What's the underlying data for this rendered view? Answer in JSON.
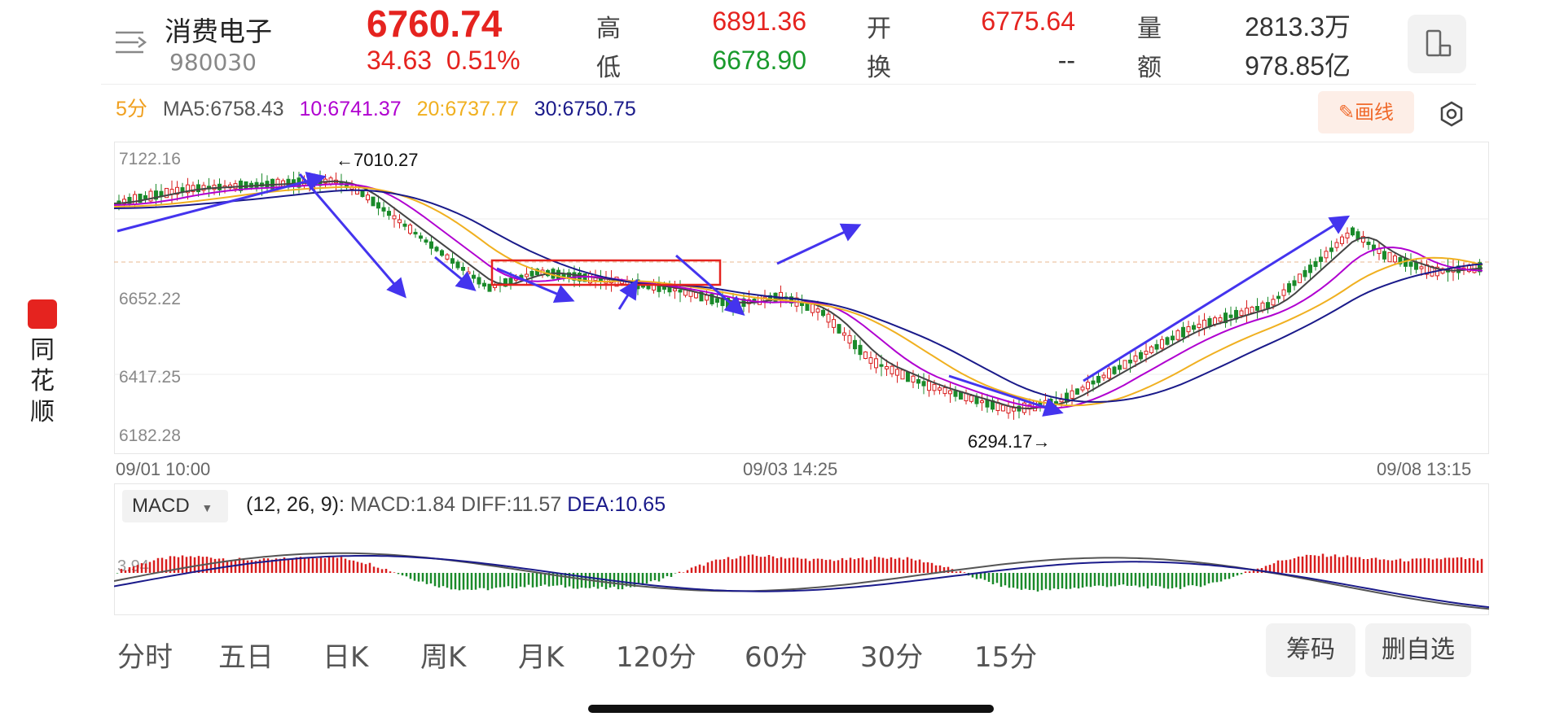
{
  "header": {
    "name": "消费电子",
    "code": "980030",
    "price": "6760.74",
    "change": "34.63",
    "change_pct": "0.51%",
    "quotes": [
      {
        "label": "高",
        "value": "6891.36",
        "color": "#e5231f"
      },
      {
        "label": "低",
        "value": "6678.90",
        "color": "#1a9a2c"
      },
      {
        "label": "开",
        "value": "6775.64",
        "color": "#e5231f"
      },
      {
        "label": "换",
        "value": "--",
        "color": "#333333"
      },
      {
        "label": "量",
        "value": "2813.3万",
        "color": "#333333"
      },
      {
        "label": "额",
        "value": "978.85亿",
        "color": "#333333"
      }
    ]
  },
  "ma_bar": {
    "period": "5分",
    "ma5": "MA5:6758.43",
    "ma10": "10:6741.37",
    "ma20": "20:6737.77",
    "ma30": "30:6750.75",
    "draw_label": "画线"
  },
  "chart_data": {
    "type": "candlestick",
    "y_ticks": [
      "7122.16",
      "6652.22",
      "6417.25",
      "6182.28"
    ],
    "x_ticks": [
      "09/01 10:00",
      "09/03 14:25",
      "09/08 13:15"
    ],
    "annotations": {
      "high": "←7010.27",
      "low": "6294.17→"
    },
    "colors": {
      "up": "#d81e1e",
      "down": "#1a8a2a",
      "ma5": "#444444",
      "ma10": "#b000d0",
      "ma20": "#f0b020",
      "ma30": "#1a1a8a",
      "trend": "#4434ee",
      "box": "#e5231f"
    }
  },
  "macd": {
    "selector": "MACD",
    "params": "(12, 26, 9):",
    "macd": "MACD:1.84",
    "diff": "DIFF:11.57",
    "dea": "DEA:10.65",
    "axis_label": "3.94"
  },
  "tabs": [
    "分时",
    "五日",
    "日K",
    "周K",
    "月K",
    "120分",
    "60分",
    "30分",
    "15分"
  ],
  "buttons": {
    "chips": "筹码",
    "remove": "删自选"
  },
  "sidebar": {
    "brand": "同花顺"
  }
}
